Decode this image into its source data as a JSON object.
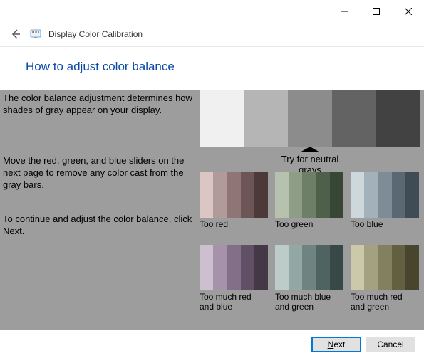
{
  "window": {
    "title": "Display Color Calibration"
  },
  "heading": "How to adjust color balance",
  "instructions": {
    "p1": "The color balance adjustment determines how shades of gray appear on your display.",
    "p2": "Move the red, green, and blue sliders on the next page to remove any color cast from the gray bars.",
    "p3": "To continue and adjust the color balance, click Next."
  },
  "neutral": {
    "pointer_label": "Try for neutral grays",
    "shades": [
      "#f0f0f0",
      "#b5b5b5",
      "#8c8c8c",
      "#636363",
      "#424242"
    ]
  },
  "examples": [
    {
      "label": "Too red",
      "bars": [
        "#dcc6c4",
        "#b19a99",
        "#8f7575",
        "#6e5555",
        "#4c3a3a"
      ]
    },
    {
      "label": "Too green",
      "bars": [
        "#b6c2ae",
        "#8d9d86",
        "#6d7f66",
        "#4e6049",
        "#384635"
      ]
    },
    {
      "label": "Too blue",
      "bars": [
        "#cdd7dc",
        "#a3b1bb",
        "#7d8c97",
        "#5a6874",
        "#3f4b55"
      ]
    },
    {
      "label": "Too much red and blue",
      "bars": [
        "#cdbfd0",
        "#a693ab",
        "#836f87",
        "#615065",
        "#443847"
      ]
    },
    {
      "label": "Too much blue and green",
      "bars": [
        "#bcccc9",
        "#93a7a4",
        "#6f8481",
        "#4f6461",
        "#384847"
      ]
    },
    {
      "label": "Too much red and green",
      "bars": [
        "#ccc9ab",
        "#a4a182",
        "#83805f",
        "#636042",
        "#47452e"
      ]
    }
  ],
  "footer": {
    "next_letter": "N",
    "next_rest": "ext",
    "cancel": "Cancel"
  }
}
